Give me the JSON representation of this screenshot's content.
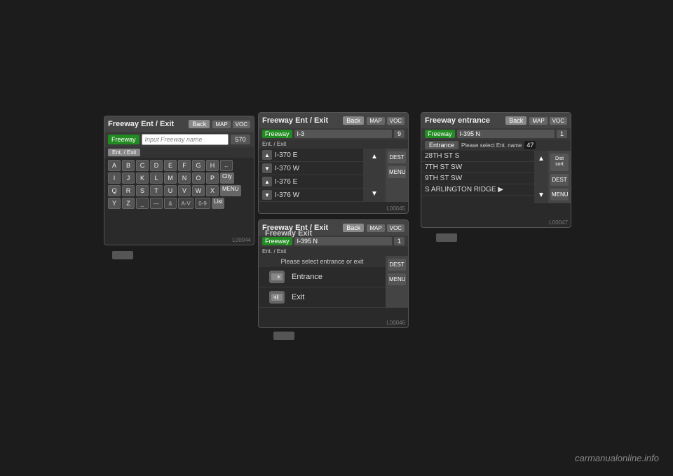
{
  "watermark": "carmanualonline.info",
  "screen1": {
    "title": "Freeway Ent / Exit",
    "back_label": "Back",
    "map_label": "MAP",
    "voc_label": "VOC",
    "freeway_label": "Freeway",
    "input_placeholder": "Input Freeway name",
    "count": "570",
    "tab_ent_exit": "Ent. / Exit",
    "side_btn1": "←",
    "keyboard_rows": [
      [
        "A",
        "B",
        "C",
        "D",
        "E",
        "F",
        "G",
        "H"
      ],
      [
        "I",
        "J",
        "K",
        "L",
        "M",
        "N",
        "O",
        "P"
      ],
      [
        "Q",
        "R",
        "S",
        "T",
        "U",
        "V",
        "W",
        "X"
      ],
      [
        "Y",
        "Z",
        "_",
        "—",
        "&",
        "A-V",
        "0-9"
      ]
    ],
    "side_btns": [
      "City",
      "MENU",
      "List"
    ],
    "code": "L00044"
  },
  "screen2": {
    "title": "Freeway Ent / Exit",
    "back_label": "Back",
    "map_label": "MAP",
    "voc_label": "VOC",
    "freeway_label": "Freeway",
    "freeway_value": "I-3",
    "count": "9",
    "ent_exit_label": "Ent. / Exit",
    "list_items": [
      {
        "text": "I-370 E"
      },
      {
        "text": "I-370 W"
      },
      {
        "text": "I-376 E"
      },
      {
        "text": "I-376 W"
      }
    ],
    "right_btns": [
      "DEST",
      "MENU"
    ],
    "code": "L00045"
  },
  "screen3": {
    "title": "Freeway Ent / Exit",
    "back_label": "Back",
    "map_label": "MAP",
    "voc_label": "VOC",
    "freeway_label": "Freeway",
    "freeway_value": "I-395 N",
    "count": "1",
    "ent_exit_label": "Ent. / Exit",
    "select_prompt": "Please select entrance or exit",
    "option1": "Entrance",
    "option2": "Exit",
    "right_btns": [
      "DEST",
      "MENU"
    ],
    "code": "L00046"
  },
  "screen4": {
    "title": "Freeway entrance",
    "back_label": "Back",
    "map_label": "MAP",
    "voc_label": "VOC",
    "freeway_label": "Freeway",
    "freeway_value": "I-395 N",
    "count": "1",
    "entrance_tab": "Entrance",
    "entrance_prompt": "Please select Ent. name",
    "entrance_count": "47",
    "list_items": [
      {
        "text": "28TH ST S"
      },
      {
        "text": "7TH ST SW"
      },
      {
        "text": "9TH ST SW"
      },
      {
        "text": "S ARLINGTON RIDGE ▶"
      }
    ],
    "right_btns": [
      "DEST",
      "MENU"
    ],
    "dist_sort": "Dist\nsort",
    "code": "L00047"
  }
}
